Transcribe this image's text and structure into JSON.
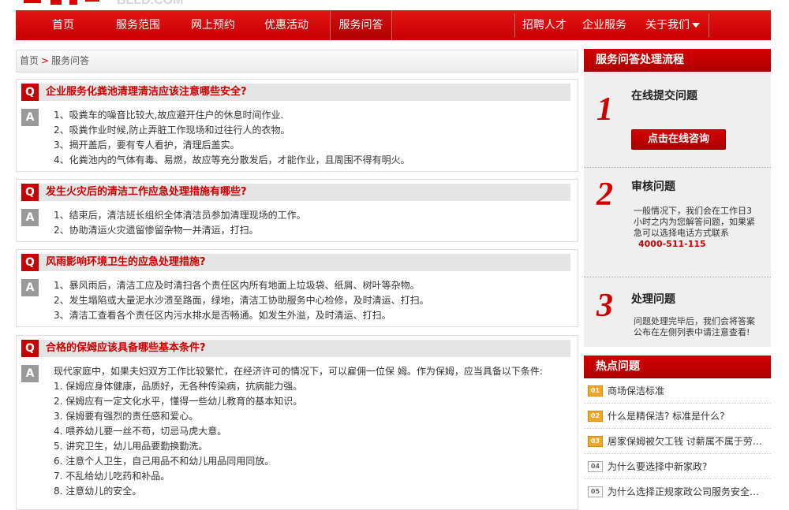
{
  "brand": {
    "domain": "BLLD.COM"
  },
  "nav": {
    "left": [
      "首页",
      "服务范围",
      "网上预约",
      "优惠活动",
      "服务问答"
    ],
    "right": [
      "招聘人才",
      "企业服务",
      "关于我们"
    ]
  },
  "breadcrumb": {
    "home": "首页",
    "sep": ">",
    "current": "服务问答"
  },
  "qa": [
    {
      "q": "企业服务化粪池清理清洁应该注意哪些安全?",
      "a": [
        "1、吸粪车的噪音比较大,故应避开住户的休息时间作业.",
        "2、吸粪作业时候,防止弄脏工作现场和过往行人的衣物。",
        "3、揭开盖后，要有专人看护，清理后盖实。",
        "4、化粪池内的气体有毒、易燃，故应等充分散发后，才能作业，且周围不得有明火。"
      ]
    },
    {
      "q": "发生火灾后的清洁工作应急处理措施有哪些?",
      "a": [
        "1、结束后，清洁班长组织全体清洁员参加清理现场的工作。",
        "2、协助清运火灾遗留惨留杂物一并清运，打扫。"
      ]
    },
    {
      "q": "风雨影响环境卫生的应急处理措施?",
      "a": [
        "1、暴风雨后，清洁工应及时清扫各个责任区内所有地面上垃圾袋、纸屑、树叶等杂物。",
        "2、发生塌陷或大量泥水沙溃至路面，绿地，清洁工协助服务中心检修，及时清运、打扫。",
        "3、清洁工查看各个责任区内污水排水是否畅通。如发生外溢，及时清运、打扫。"
      ]
    },
    {
      "q": "合格的保姆应该具备哪些基本条件?",
      "a": [
        "现代家庭中，如果夫妇双方工作比较繁忙，在经济许可的情况下，可以雇佣一位保 姆。作为保姆，应当具备以下条件:",
        "1. 保姆应身体健康，品质好，无各种传染病，抗病能力强。",
        "2. 保姆应有一定文化水平，懂得一些幼儿教育的基本知识。",
        "3. 保姆要有强烈的责任感和爱心。",
        "4. 喂养幼儿要一丝不苟，切忌马虎大意。",
        "5. 讲究卫生，幼儿用品要勤换勤洗。",
        "6. 注意个人卫生，自己用品不和幼儿用品同用同放。",
        "7. 不乱给幼儿吃药和补品。",
        "8. 注意幼儿的安全。"
      ]
    }
  ],
  "process": {
    "title": "服务问答处理流程",
    "steps": [
      {
        "num": "1",
        "title": "在线提交问题",
        "button": "点击在线咨询"
      },
      {
        "num": "2",
        "title": "审核问题",
        "desc": "一般情况下，我们会在工作日3小时之内为您解答问题，如果紧急可以选择电话方式联系",
        "phone": "4000-511-115"
      },
      {
        "num": "3",
        "title": "处理问题",
        "desc": "问题处理完毕后，我们会将答案公布在左侧列表中请注意查看!"
      }
    ]
  },
  "hot": {
    "title": "热点问题",
    "items": [
      {
        "badge": "01",
        "text": "商场保洁标准",
        "style": "orange"
      },
      {
        "badge": "02",
        "text": "什么是精保洁? 标准是什么?",
        "style": "orange"
      },
      {
        "badge": "03",
        "text": "居家保姆被欠工钱 讨薪属不属于劳务纠纷",
        "style": "orange"
      },
      {
        "badge": "04",
        "text": "为什么要选择中新家政?",
        "style": "gray"
      },
      {
        "badge": "05",
        "text": "为什么选择正规家政公司服务安全有保障",
        "style": "gray"
      }
    ]
  },
  "colors": {
    "brand_red": "#c40000",
    "badge_orange": "#f6a623"
  }
}
